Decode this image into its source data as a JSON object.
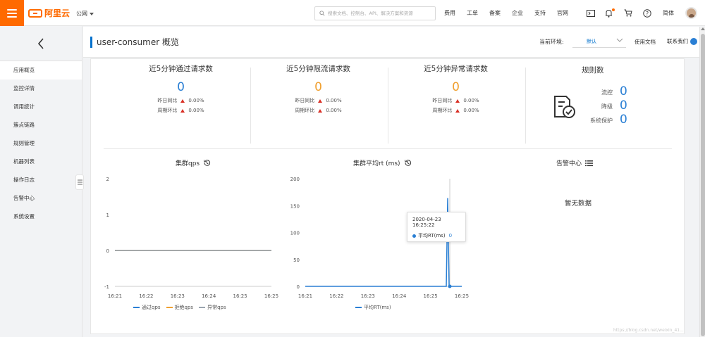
{
  "topbar": {
    "brand": "阿里云",
    "region": "公网",
    "search_placeholder": "搜索文档、控制台、API、解决方案和资源",
    "links": [
      "费用",
      "工单",
      "备案",
      "企业",
      "支持",
      "官网"
    ],
    "language": "简体",
    "accent": "#ff6a00"
  },
  "sidebar": {
    "items": [
      {
        "label": "应用概览",
        "active": true
      },
      {
        "label": "监控详情",
        "active": false
      },
      {
        "label": "调用统计",
        "active": false
      },
      {
        "label": "簇点链路",
        "active": false
      },
      {
        "label": "规则管理",
        "active": false
      },
      {
        "label": "机器列表",
        "active": false
      },
      {
        "label": "操作日志",
        "active": false
      },
      {
        "label": "告警中心",
        "active": false
      },
      {
        "label": "系统设置",
        "active": false
      }
    ]
  },
  "header": {
    "title": "user-consumer 概览",
    "env_label": "当前环境:",
    "env_value": "默认",
    "doc_link": "使用文档",
    "contact": "联系我们"
  },
  "stats": [
    {
      "title": "近5分钟通过请求数",
      "value": "0",
      "color": "#2a7fd4",
      "yesterday_label": "昨日同比",
      "yesterday_value": "0.00%",
      "week_label": "周期环比",
      "week_value": "0.00%"
    },
    {
      "title": "近5分钟限流请求数",
      "value": "0",
      "color": "#f0a030",
      "yesterday_label": "昨日同比",
      "yesterday_value": "0.00%",
      "week_label": "周期环比",
      "week_value": "0.00%"
    },
    {
      "title": "近5分钟异常请求数",
      "value": "0",
      "color": "#f0a030",
      "yesterday_label": "昨日同比",
      "yesterday_value": "0.00%",
      "week_label": "周期环比",
      "week_value": "0.00%"
    }
  ],
  "rules": {
    "title": "规则数",
    "items": [
      {
        "label": "流控",
        "value": "0"
      },
      {
        "label": "降级",
        "value": "0"
      },
      {
        "label": "系统保护",
        "value": "0"
      }
    ]
  },
  "charts": {
    "qps_title": "集群qps",
    "rt_title": "集群平均rt (ms)",
    "alert_title": "告警中心",
    "alert_empty": "暂无数据"
  },
  "chart_data": [
    {
      "type": "line",
      "title": "集群qps",
      "x": [
        "16:21",
        "16:22",
        "16:23",
        "16:24",
        "16:25",
        "16:25"
      ],
      "y_ticks": [
        "2",
        "1",
        "0",
        "-1"
      ],
      "ylim": [
        -1,
        2
      ],
      "series": [
        {
          "name": "通过qps",
          "color": "#2a7fd4",
          "values": [
            0,
            0,
            0,
            0,
            0,
            0
          ]
        },
        {
          "name": "拒绝qps",
          "color": "#f0a030",
          "values": [
            0,
            0,
            0,
            0,
            0,
            0
          ]
        },
        {
          "name": "异常qps",
          "color": "#9aa4af",
          "values": [
            0,
            0,
            0,
            0,
            0,
            0
          ]
        }
      ]
    },
    {
      "type": "line",
      "title": "集群平均rt (ms)",
      "x": [
        "16:21",
        "16:22",
        "16:23",
        "16:24",
        "16:25",
        "16:25"
      ],
      "y_ticks": [
        "200",
        "150",
        "100",
        "50",
        "0"
      ],
      "ylim": [
        0,
        200
      ],
      "series": [
        {
          "name": "平均RT(ms)",
          "color": "#2a7fd4",
          "spike_value": 164
        }
      ],
      "tooltip": {
        "time": "2020-04-23 16:25:22",
        "label": "平均RT(ms)",
        "value": "0"
      }
    }
  ],
  "watermark": "https://blog.csdn.net/weixin_41..."
}
